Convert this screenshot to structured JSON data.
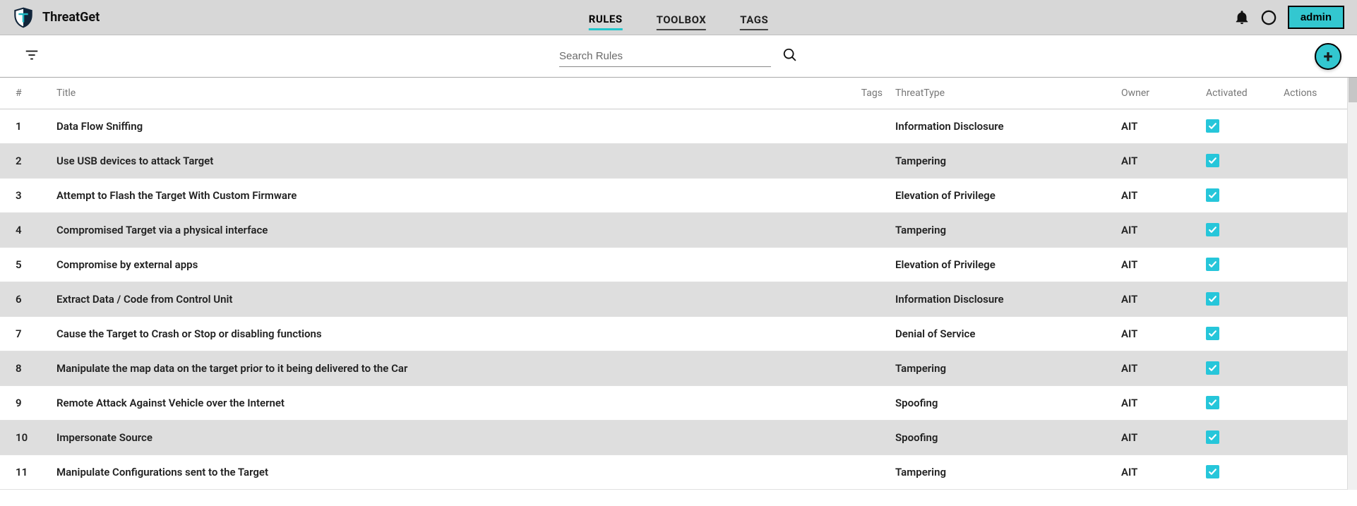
{
  "header": {
    "app_name": "ThreatGet",
    "nav": [
      {
        "label": "RULES",
        "active": true
      },
      {
        "label": "TOOLBOX",
        "active": false
      },
      {
        "label": "TAGS",
        "active": false
      }
    ],
    "admin_label": "admin"
  },
  "toolbar": {
    "search_placeholder": "Search Rules",
    "add_symbol": "+"
  },
  "table": {
    "columns": {
      "num": "#",
      "title": "Title",
      "tags": "Tags",
      "type": "ThreatType",
      "owner": "Owner",
      "activated": "Activated",
      "actions": "Actions"
    },
    "rows": [
      {
        "num": "1",
        "title": "Data Flow Sniffing",
        "type": "Information Disclosure",
        "owner": "AIT",
        "activated": true
      },
      {
        "num": "2",
        "title": "Use USB devices to attack Target",
        "type": "Tampering",
        "owner": "AIT",
        "activated": true
      },
      {
        "num": "3",
        "title": "Attempt to Flash the Target With Custom Firmware",
        "type": "Elevation of Privilege",
        "owner": "AIT",
        "activated": true
      },
      {
        "num": "4",
        "title": "Compromised Target via a physical interface",
        "type": "Tampering",
        "owner": "AIT",
        "activated": true
      },
      {
        "num": "5",
        "title": "Compromise by external apps",
        "type": "Elevation of Privilege",
        "owner": "AIT",
        "activated": true
      },
      {
        "num": "6",
        "title": "Extract Data / Code from Control Unit",
        "type": "Information Disclosure",
        "owner": "AIT",
        "activated": true
      },
      {
        "num": "7",
        "title": "Cause the Target to Crash or Stop or disabling functions",
        "type": "Denial of Service",
        "owner": "AIT",
        "activated": true
      },
      {
        "num": "8",
        "title": "Manipulate the map data on the target prior to it being delivered to the Car",
        "type": "Tampering",
        "owner": "AIT",
        "activated": true
      },
      {
        "num": "9",
        "title": "Remote Attack Against Vehicle over the Internet",
        "type": "Spoofing",
        "owner": "AIT",
        "activated": true
      },
      {
        "num": "10",
        "title": "Impersonate Source",
        "type": "Spoofing",
        "owner": "AIT",
        "activated": true
      },
      {
        "num": "11",
        "title": "Manipulate Configurations sent to the Target",
        "type": "Tampering",
        "owner": "AIT",
        "activated": true
      }
    ]
  }
}
